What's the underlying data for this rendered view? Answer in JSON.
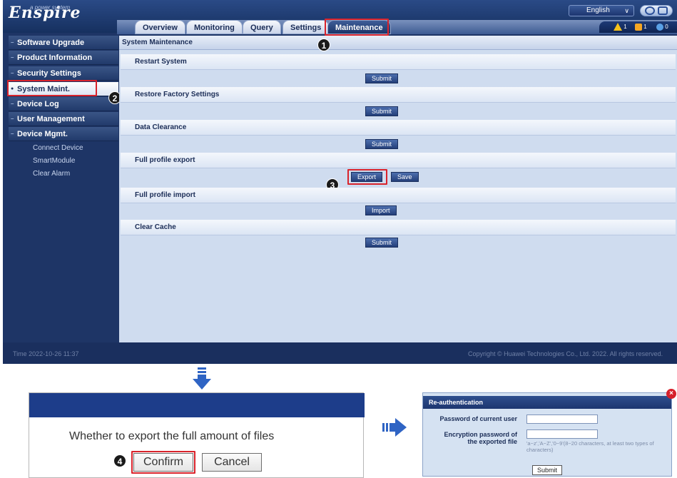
{
  "header": {
    "logo": "Enspire",
    "logo_sub": "a power system",
    "language": "English",
    "tabs": [
      {
        "label": "Overview"
      },
      {
        "label": "Monitoring"
      },
      {
        "label": "Query"
      },
      {
        "label": "Settings"
      },
      {
        "label": "Maintenance",
        "active": true
      }
    ],
    "alarms": [
      {
        "icon": "warning-triangle-icon",
        "count": "1",
        "color": "#f5c11a"
      },
      {
        "icon": "major-alarm-icon",
        "count": "1",
        "color": "#f5a623"
      },
      {
        "icon": "minor-alarm-icon",
        "count": "0",
        "color": "#5aa0e6"
      }
    ]
  },
  "sidebar": {
    "items": [
      {
        "label": "Software Upgrade"
      },
      {
        "label": "Product Information"
      },
      {
        "label": "Security Settings"
      },
      {
        "label": "System Maint.",
        "active": true
      },
      {
        "label": "Device Log"
      },
      {
        "label": "User Management"
      },
      {
        "label": "Device Mgmt."
      }
    ],
    "sub_items": [
      {
        "label": "Connect Device"
      },
      {
        "label": "SmartModule"
      },
      {
        "label": "Clear Alarm"
      }
    ]
  },
  "main": {
    "title": "System Maintenance",
    "sections": [
      {
        "title": "Restart System",
        "buttons": [
          "Submit"
        ]
      },
      {
        "title": "Restore Factory Settings",
        "buttons": [
          "Submit"
        ]
      },
      {
        "title": "Data Clearance",
        "buttons": [
          "Submit"
        ]
      },
      {
        "title": "Full profile export",
        "buttons": [
          "Export",
          "Save"
        ]
      },
      {
        "title": "Full profile import",
        "buttons": [
          "Import"
        ]
      },
      {
        "title": "Clear Cache",
        "buttons": [
          "Submit"
        ]
      }
    ]
  },
  "footer": {
    "time": "Time  2022-10-26 11:37",
    "copyright": "Copyright © Huawei Technologies Co., Ltd. 2022. All rights reserved."
  },
  "callouts": [
    "1",
    "2",
    "3",
    "4"
  ],
  "confirm_dialog": {
    "message": "Whether to export the full amount of files",
    "confirm": "Confirm",
    "cancel": "Cancel"
  },
  "reauth_dialog": {
    "title": "Re-authentication",
    "password_label": "Password of current user",
    "encryption_label_1": "Encryption password of",
    "encryption_label_2": "the exported file",
    "hint": "'a~z','A~Z','0~9'(8~20 characters, at least two types of characters)",
    "submit": "Submit"
  },
  "colors": {
    "accent": "#1e3566",
    "highlight": "#d9232b",
    "dialog_bar": "#1d3d8a"
  }
}
